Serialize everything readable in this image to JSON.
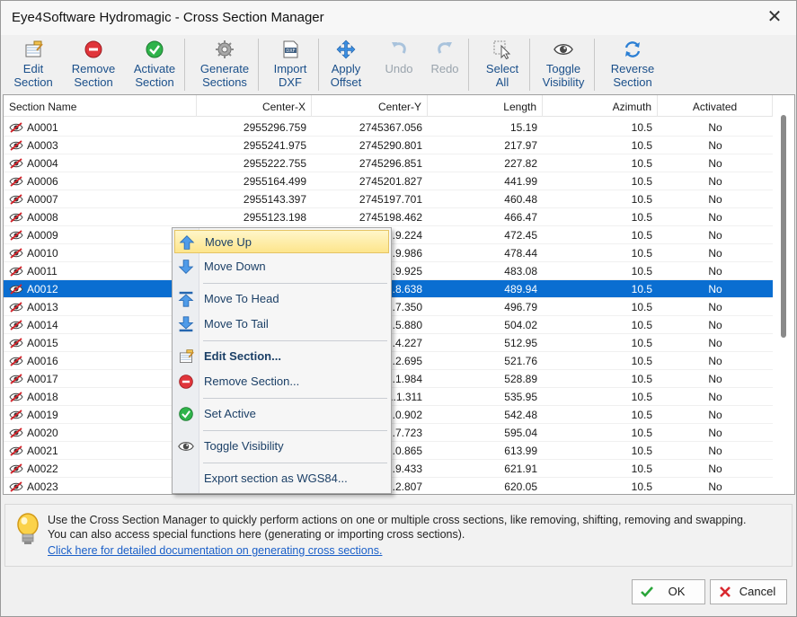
{
  "window": {
    "title": "Eye4Software Hydromagic - Cross Section Manager",
    "close": "✕"
  },
  "toolbar": [
    {
      "id": "edit",
      "line1": "Edit",
      "line2": "Section",
      "icon": "edit-section-icon",
      "enabled": true
    },
    {
      "id": "remove",
      "line1": "Remove",
      "line2": "Section",
      "icon": "remove-icon",
      "enabled": true
    },
    {
      "id": "activate",
      "line1": "Activate",
      "line2": "Section",
      "icon": "activate-icon",
      "enabled": true
    },
    {
      "id": "generate",
      "line1": "Generate",
      "line2": "Sections",
      "icon": "gear-icon",
      "enabled": true
    },
    {
      "id": "import",
      "line1": "Import",
      "line2": "DXF",
      "icon": "dxf-icon",
      "enabled": true
    },
    {
      "id": "offset",
      "line1": "Apply",
      "line2": "Offset",
      "icon": "move-arrows-icon",
      "enabled": true
    },
    {
      "id": "undo",
      "line1": "Undo",
      "line2": "",
      "icon": "undo-icon",
      "enabled": false
    },
    {
      "id": "redo",
      "line1": "Redo",
      "line2": "",
      "icon": "redo-icon",
      "enabled": false
    },
    {
      "id": "select",
      "line1": "Select",
      "line2": "All",
      "icon": "select-all-icon",
      "enabled": true
    },
    {
      "id": "visibility",
      "line1": "Toggle",
      "line2": "Visibility",
      "icon": "eye-icon",
      "enabled": true
    },
    {
      "id": "reverse",
      "line1": "Reverse",
      "line2": "Section",
      "icon": "reverse-icon",
      "enabled": true
    }
  ],
  "table": {
    "columns": [
      "Section Name",
      "Center-X",
      "Center-Y",
      "Length",
      "Azimuth",
      "Activated"
    ],
    "selected_index": 9,
    "rows": [
      [
        "A0001",
        "2955296.759",
        "2745367.056",
        "15.19",
        "10.5",
        "No"
      ],
      [
        "A0003",
        "2955241.975",
        "2745290.801",
        "217.97",
        "10.5",
        "No"
      ],
      [
        "A0004",
        "2955222.755",
        "2745296.851",
        "227.82",
        "10.5",
        "No"
      ],
      [
        "A0006",
        "2955164.499",
        "2745201.827",
        "441.99",
        "10.5",
        "No"
      ],
      [
        "A0007",
        "2955143.397",
        "2745197.701",
        "460.48",
        "10.5",
        "No"
      ],
      [
        "A0008",
        "2955123.198",
        "2745198.462",
        "466.47",
        "10.5",
        "No"
      ],
      [
        "A0009",
        "",
        "...9.224",
        "472.45",
        "10.5",
        "No"
      ],
      [
        "A0010",
        "",
        "...9.986",
        "478.44",
        "10.5",
        "No"
      ],
      [
        "A0011",
        "",
        "...9.925",
        "483.08",
        "10.5",
        "No"
      ],
      [
        "A0012",
        "",
        "...8.638",
        "489.94",
        "10.5",
        "No"
      ],
      [
        "A0013",
        "",
        "...7.350",
        "496.79",
        "10.5",
        "No"
      ],
      [
        "A0014",
        "",
        "...5.880",
        "504.02",
        "10.5",
        "No"
      ],
      [
        "A0015",
        "",
        "...4.227",
        "512.95",
        "10.5",
        "No"
      ],
      [
        "A0016",
        "",
        "...2.695",
        "521.76",
        "10.5",
        "No"
      ],
      [
        "A0017",
        "",
        "...1.984",
        "528.89",
        "10.5",
        "No"
      ],
      [
        "A0018",
        "",
        "...1.311",
        "535.95",
        "10.5",
        "No"
      ],
      [
        "A0019",
        "",
        "...0.902",
        "542.48",
        "10.5",
        "No"
      ],
      [
        "A0020",
        "",
        "...7.723",
        "595.04",
        "10.5",
        "No"
      ],
      [
        "A0021",
        "",
        "...0.865",
        "613.99",
        "10.5",
        "No"
      ],
      [
        "A0022",
        "",
        "...9.433",
        "621.91",
        "10.5",
        "No"
      ],
      [
        "A0023",
        "",
        "...2.807",
        "620.05",
        "10.5",
        "No"
      ]
    ]
  },
  "context_menu": [
    {
      "label": "Move Up",
      "icon": "arrow-up-icon",
      "highlight": true
    },
    {
      "label": "Move Down",
      "icon": "arrow-down-icon"
    },
    {
      "sep": true
    },
    {
      "label": "Move To Head",
      "icon": "arrow-to-head-icon"
    },
    {
      "label": "Move To Tail",
      "icon": "arrow-to-tail-icon"
    },
    {
      "sep": true
    },
    {
      "label": "Edit Section...",
      "icon": "edit-section-icon",
      "bold": true
    },
    {
      "label": "Remove Section...",
      "icon": "remove-icon"
    },
    {
      "sep": true
    },
    {
      "label": "Set Active",
      "icon": "check-icon"
    },
    {
      "sep": true
    },
    {
      "label": "Toggle Visibility",
      "icon": "eye-icon"
    },
    {
      "sep": true
    },
    {
      "label": "Export section as WGS84..."
    }
  ],
  "info": {
    "text": "Use the Cross Section Manager to quickly perform actions on one or multiple cross sections, like removing, shifting, removing and swapping. You can also access special functions here (generating or importing cross sections).",
    "link": "Click here for detailed documentation on generating cross sections."
  },
  "buttons": {
    "ok": "OK",
    "cancel": "Cancel"
  },
  "colors": {
    "selection": "#0a6ed1",
    "link": "#1a5fc8",
    "toolbar_text": "#1a4f8a"
  }
}
